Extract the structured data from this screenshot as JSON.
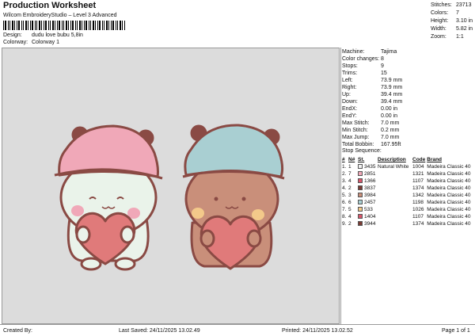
{
  "header": {
    "title": "Production Worksheet",
    "subtitle": "Wilcom EmbroideryStudio – Level 3 Advanced",
    "design_label": "Design:",
    "design_value": "dudu love bubu 5,8in",
    "colorway_label": "Colorway:",
    "colorway_value": "Colorway 1"
  },
  "stats": [
    {
      "key": "Stitches:",
      "value": "23713"
    },
    {
      "key": "Colors:",
      "value": "7"
    },
    {
      "key": "Height:",
      "value": "3.10 in"
    },
    {
      "key": "Width:",
      "value": "5.82 in"
    },
    {
      "key": "Zoom:",
      "value": "1:1"
    }
  ],
  "machine": [
    {
      "key": "Machine:",
      "value": "Tajima"
    },
    {
      "key": "Color changes:",
      "value": "8"
    },
    {
      "key": "Stops:",
      "value": "9"
    },
    {
      "key": "Trims:",
      "value": "15"
    },
    {
      "key": "Left:",
      "value": "73.9 mm"
    },
    {
      "key": "Right:",
      "value": "73.9 mm"
    },
    {
      "key": "Up:",
      "value": "39.4 mm"
    },
    {
      "key": "Down:",
      "value": "39.4 mm"
    },
    {
      "key": "EndX:",
      "value": "0.00 in"
    },
    {
      "key": "EndY:",
      "value": "0.00 in"
    },
    {
      "key": "Max Stitch:",
      "value": "7.0 mm"
    },
    {
      "key": "Min Stitch:",
      "value": "0.2 mm"
    },
    {
      "key": "Max Jump:",
      "value": "7.0 mm"
    },
    {
      "key": "Total Bobbin:",
      "value": "167.95ft"
    }
  ],
  "stop_sequence": {
    "title": "Stop Sequence:",
    "headers": [
      "#",
      "N#",
      "St.",
      "Description",
      "Code",
      "Brand"
    ],
    "rows": [
      {
        "num": "1.",
        "n": "1",
        "color": "#f2f2f2",
        "st": "3435",
        "desc": "Natural White",
        "code": "1004",
        "brand": "Madeira Classic 40"
      },
      {
        "num": "2.",
        "n": "7",
        "color": "#f0a8b8",
        "st": "2851",
        "desc": "",
        "code": "1321",
        "brand": "Madeira Classic 40"
      },
      {
        "num": "3.",
        "n": "4",
        "color": "#d9566b",
        "st": "1366",
        "desc": "",
        "code": "1107",
        "brand": "Madeira Classic 40"
      },
      {
        "num": "4.",
        "n": "2",
        "color": "#7a3b34",
        "st": "3837",
        "desc": "",
        "code": "1374",
        "brand": "Madeira Classic 40"
      },
      {
        "num": "5.",
        "n": "3",
        "color": "#c98f7a",
        "st": "3984",
        "desc": "",
        "code": "1342",
        "brand": "Madeira Classic 40"
      },
      {
        "num": "6.",
        "n": "6",
        "color": "#a9cfd2",
        "st": "2457",
        "desc": "",
        "code": "1198",
        "brand": "Madeira Classic 40"
      },
      {
        "num": "7.",
        "n": "5",
        "color": "#f3c98a",
        "st": "533",
        "desc": "",
        "code": "1026",
        "brand": "Madeira Classic 40"
      },
      {
        "num": "8.",
        "n": "4",
        "color": "#d9566b",
        "st": "1404",
        "desc": "",
        "code": "1107",
        "brand": "Madeira Classic 40"
      },
      {
        "num": "9.",
        "n": "2",
        "color": "#7a3b34",
        "st": "3944",
        "desc": "",
        "code": "1374",
        "brand": "Madeira Classic 40"
      }
    ]
  },
  "footer": {
    "created_by": "Created By:",
    "last_saved": "Last Saved: 24/11/2025 13.02.49",
    "printed": "Printed: 24/11/2025 13.02.52",
    "page": "Page 1 of 1"
  },
  "colors": {
    "canvas": "#dcdcdc",
    "outline": "#8a4a44",
    "hat_pink": "#f0a8b8",
    "hat_blue": "#a9cfd2",
    "bear_white": "#eaf3ea",
    "bear_brown": "#c98f7a",
    "heart": "#e07a7a",
    "cheek_yellow": "#f3c98a"
  }
}
